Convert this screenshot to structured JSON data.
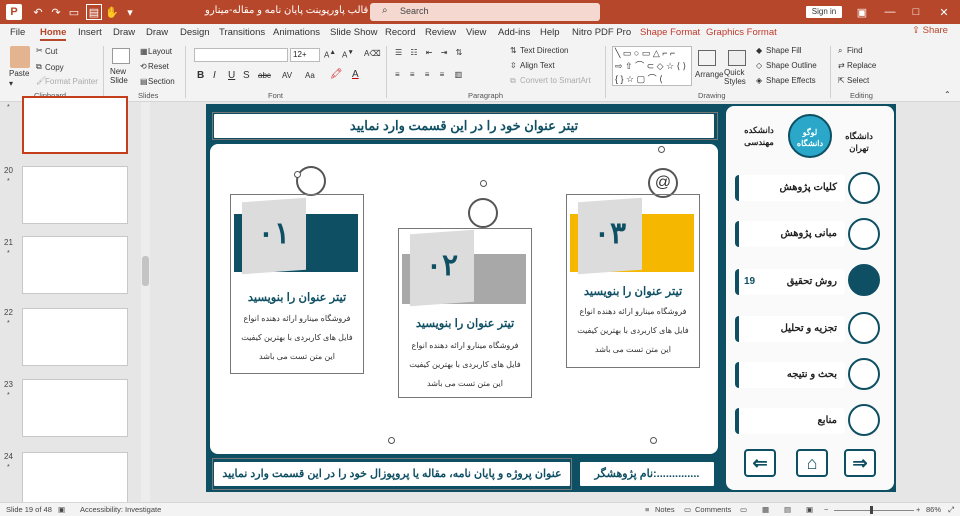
{
  "titlebar": {
    "document_title": "قالب پاورپوینت پایان نامه و مقاله-مینارو  -  PowerPoint",
    "search_placeholder": "Search",
    "sign_in": "Sign in"
  },
  "menu": {
    "tabs": [
      "File",
      "Home",
      "Insert",
      "Draw",
      "Draw",
      "Design",
      "Transitions",
      "Animations",
      "Slide Show",
      "Record",
      "Review",
      "View",
      "Add-ins",
      "Help",
      "Nitro PDF Pro"
    ],
    "contextual_tabs": [
      "Shape Format",
      "Graphics Format"
    ],
    "share": "Share"
  },
  "ribbon": {
    "clipboard": {
      "paste": "Paste",
      "cut": "Cut",
      "copy": "Copy",
      "format_painter": "Format Painter",
      "group": "Clipboard"
    },
    "slides": {
      "new_slide": "New Slide",
      "layout": "Layout",
      "reset": "Reset",
      "section": "Section",
      "group": "Slides"
    },
    "font": {
      "size": "12+",
      "group": "Font",
      "bold": "B",
      "italic": "I",
      "underline": "U",
      "strike": "S",
      "abc": "abc",
      "av": "AV",
      "aa": "Aa"
    },
    "paragraph": {
      "text_direction": "Text Direction",
      "align_text": "Align Text",
      "convert": "Convert to SmartArt",
      "group": "Paragraph"
    },
    "drawing": {
      "arrange": "Arrange",
      "quick_styles": "Quick Styles",
      "shape_fill": "Shape Fill",
      "shape_outline": "Shape Outline",
      "shape_effects": "Shape Effects",
      "group": "Drawing"
    },
    "editing": {
      "find": "Find",
      "replace": "Replace",
      "select": "Select",
      "group": "Editing"
    }
  },
  "thumbnails": [
    {
      "num": "",
      "star": "*"
    },
    {
      "num": "20",
      "star": "*"
    },
    {
      "num": "21",
      "star": "*"
    },
    {
      "num": "22",
      "star": "*"
    },
    {
      "num": "23",
      "star": "*"
    },
    {
      "num": "24",
      "star": "*"
    }
  ],
  "slide": {
    "header_title": "تیتر عنوان خود را در این قسمت وارد نمایید",
    "footer_left": "عنوان پروژه و پایان نامه، مقاله یا پروپوزال خود را در این قسمت وارد نمایید",
    "footer_right": "نام پژوهشگر:..............",
    "cards": [
      {
        "number": "۰۱",
        "title": "تیتر عنوان را بنویسید",
        "line1": "فروشگاه مینارو ارائه دهنده انواع",
        "line2": "فایل های کاربردی با بهترین کیفیت",
        "line3": "این متن تست می باشد",
        "accent": "#0e4f63"
      },
      {
        "number": "۰۲",
        "title": "تیتر عنوان را بنویسید",
        "line1": "فروشگاه مینارو ارائه دهنده انواع",
        "line2": "فایل های کاربردی با بهترین کیفیت",
        "line3": "این متن تست می باشد",
        "accent": "#a8a8a8"
      },
      {
        "number": "۰۳",
        "title": "تیتر عنوان را بنویسید",
        "line1": "فروشگاه مینارو ارائه دهنده انواع",
        "line2": "فایل های کاربردی با بهترین کیفیت",
        "line3": "این متن تست می باشد",
        "accent": "#f5b700"
      }
    ],
    "sidebar": {
      "faculty_left": "دانشکده مهندسی",
      "faculty_right": "دانشگاه تهران",
      "logo_text": "لوگو دانشگاه",
      "items": [
        "کلیات پژوهش",
        "مبانی پژوهش",
        "روش تحقیق",
        "تجزیه و تحلیل",
        "بحث و نتیجه",
        "منابع"
      ],
      "page_number": "19"
    }
  },
  "status": {
    "slide_info": "Slide 19 of 48",
    "accessibility": "Accessibility: Investigate",
    "notes": "Notes",
    "comments": "Comments",
    "zoom": "86%"
  },
  "colors": {
    "accent": "#b7472a",
    "slide_dark": "#0e4f63",
    "yellow": "#f5b700"
  }
}
